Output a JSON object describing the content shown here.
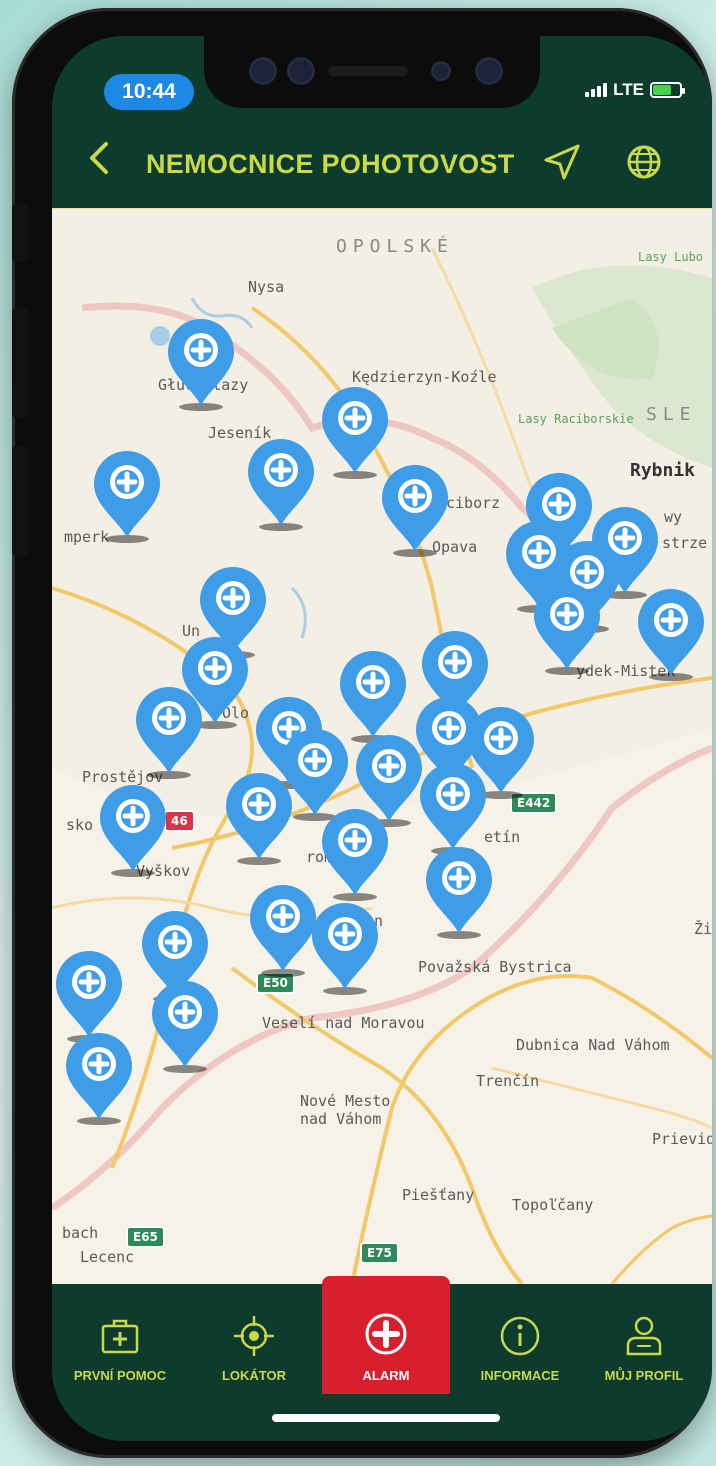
{
  "status_bar": {
    "time": "10:44",
    "network": "LTE"
  },
  "header": {
    "back_icon": "chevron-left-icon",
    "title": "NEMOCNICE POHOTOVOST",
    "nav_icon": "navigation-arrow-icon",
    "globe_icon": "globe-icon"
  },
  "map": {
    "labels": {
      "opolske": "OPOLSKÉ",
      "lasy_lubo": "Lasy Lubo",
      "nysa": "Nysa",
      "glucholazy": "Głuchołazy",
      "kedzierzyn": "Kędzierzyn-Koźle",
      "lasy_raciborskie": "Lasy Raciborskie",
      "sle": "SLE",
      "jesenik": "Jeseník",
      "rybnik": "Rybnik",
      "raciborz": "ciborz",
      "sumperk": "mperk",
      "opava": "Opava",
      "wy": "wy",
      "strze": "strze",
      "unicov": "Un",
      "frydek": "ydek-Mistek",
      "olomouc": "Olo",
      "prostejov": "Prostějov",
      "skov": "sko",
      "vyskov": "Vyškov",
      "kromeriz": "roměř",
      "vsetin": "etín",
      "n": "n",
      "povazska": "Považská Bystrica",
      "veseli": "Veselí nad Moravou",
      "dubnica": "Dubnica Nad Váhom",
      "trencin": "Trenčín",
      "nove_mesto": "Nové Mesto",
      "nad_vahom": "nad Váhom",
      "prievid": "Prievid",
      "piestany": "Piešťany",
      "topolcany": "Topoľčany",
      "bach": "bach",
      "lecenc": "Lecenc",
      "zi": "Ži"
    },
    "road_shields": {
      "e442": "E442",
      "e50": "E50",
      "e65": "E65",
      "e75": "E75",
      "r46": "46"
    },
    "pin_count": 30
  },
  "tabs": [
    {
      "label": "PRVNÍ POMOC",
      "icon": "first-aid-kit-icon"
    },
    {
      "label": "LOKÁTOR",
      "icon": "locator-crosshair-icon"
    },
    {
      "label": "ALARM",
      "icon": "alarm-cross-icon"
    },
    {
      "label": "INFORMACE",
      "icon": "info-icon"
    },
    {
      "label": "MŮJ PROFIL",
      "icon": "profile-icon"
    }
  ],
  "colors": {
    "header_bg": "#0d3b2e",
    "accent": "#c9d94a",
    "alarm": "#d81f2e",
    "pin": "#3f9de8",
    "time_pill": "#1e88e5"
  }
}
